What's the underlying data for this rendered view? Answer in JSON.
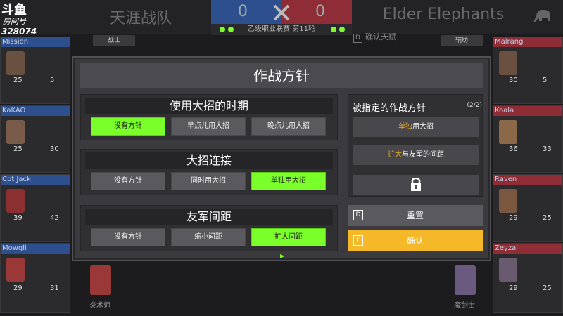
{
  "hud": {
    "left_team": "天涯战队",
    "right_team": "Elder Elephants",
    "left_score": "0",
    "right_score": "0",
    "league": "乙级职业联赛 第11轮",
    "confirm_talent_key": "D",
    "confirm_talent": "确认天赋",
    "col_left": "战士",
    "col_right": "辅助",
    "class_left_bottom": "炎术师",
    "class_right_bottom": "魔剑士"
  },
  "douyu": {
    "logo": "斗鱼",
    "room": "房间号",
    "id": "328074"
  },
  "left_players": [
    {
      "name": "Mission",
      "stat1": "25",
      "stat2": "5"
    },
    {
      "name": "KaKAO",
      "stat1": "25",
      "stat2": "30"
    },
    {
      "name": "Cpt Jack",
      "stat1": "39",
      "stat2": "42"
    },
    {
      "name": "Mowgli",
      "stat1": "29",
      "stat2": "31"
    }
  ],
  "right_players": [
    {
      "name": "Malrang",
      "stat1": "30",
      "stat2": "5"
    },
    {
      "name": "Koala",
      "stat1": "36",
      "stat2": "33"
    },
    {
      "name": "Raven",
      "stat1": "29",
      "stat2": "25"
    },
    {
      "name": "Zeyzal",
      "stat1": "29",
      "stat2": "25"
    }
  ],
  "modal": {
    "title": "作战方针",
    "groups": [
      {
        "title": "使用大招的时期",
        "options": [
          "没有方针",
          "早点儿用大招",
          "晚点儿用大招"
        ],
        "selected": 0
      },
      {
        "title": "大招连接",
        "options": [
          "没有方针",
          "同时用大招",
          "单独用大招"
        ],
        "selected": 2
      },
      {
        "title": "友军间距",
        "options": [
          "没有方针",
          "缩小间距",
          "扩大间距"
        ],
        "selected": 2
      }
    ],
    "assigned": {
      "title": "被指定的作战方针",
      "count": "(2/2)",
      "slot1_hl": "单独",
      "slot1_rest": "用大招",
      "slot2_hl": "扩大",
      "slot2_rest": "与友军的间距"
    },
    "reset_key": "D",
    "reset": "重置",
    "confirm_key": "F",
    "confirm": "确认"
  },
  "colors": {
    "selected": "#7bff2a",
    "confirm": "#f5b828",
    "highlight": "#f0b020",
    "blue_team": "#2d4f8e",
    "red_team": "#8e2d35"
  }
}
